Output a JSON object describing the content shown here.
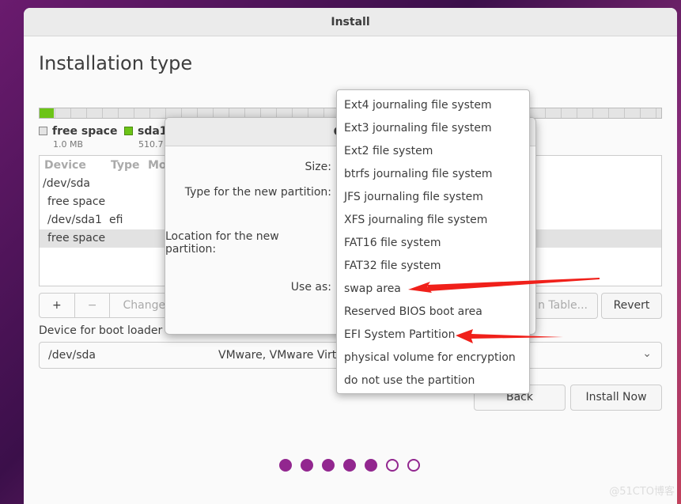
{
  "window": {
    "title": "Install"
  },
  "page": {
    "title": "Installation type"
  },
  "legend": [
    {
      "name": "free space",
      "size": "1.0 MB",
      "color": "#e4e4e4"
    },
    {
      "name": "sda1",
      "size": "510.7",
      "color": "#6cc417"
    }
  ],
  "table": {
    "headers": [
      "Device",
      "Type",
      "Mo"
    ],
    "rows": [
      {
        "device": "/dev/sda",
        "type": ""
      },
      {
        "device": "free space",
        "type": ""
      },
      {
        "device": "/dev/sda1",
        "type": "efi"
      },
      {
        "device": "free space",
        "type": "",
        "selected": true
      }
    ]
  },
  "toolbar": {
    "add": "+",
    "remove": "−",
    "change": "Change...",
    "new_table": "n Table...",
    "revert": "Revert"
  },
  "bootloader": {
    "label": "Device for boot loader i",
    "device": "/dev/sda",
    "desc": "VMware, VMware Virtu"
  },
  "buttons": {
    "back": "Back",
    "install": "Install Now"
  },
  "steps": {
    "total": 7,
    "done": 5
  },
  "dialog": {
    "title": "Creat",
    "size_label": "Size:",
    "type_label": "Type for the new partition:",
    "location_label": "Location for the new partition:",
    "use_as_label": "Use as:"
  },
  "menu_items": [
    "Ext4 journaling file system",
    "Ext3 journaling file system",
    "Ext2 file system",
    "btrfs journaling file system",
    "JFS journaling file system",
    "XFS journaling file system",
    "FAT16 file system",
    "FAT32 file system",
    "swap area",
    "Reserved BIOS boot area",
    "EFI System Partition",
    "physical volume for encryption",
    "do not use the partition"
  ],
  "annotation_color": "#f0201a",
  "watermark": "@51CTO博客"
}
